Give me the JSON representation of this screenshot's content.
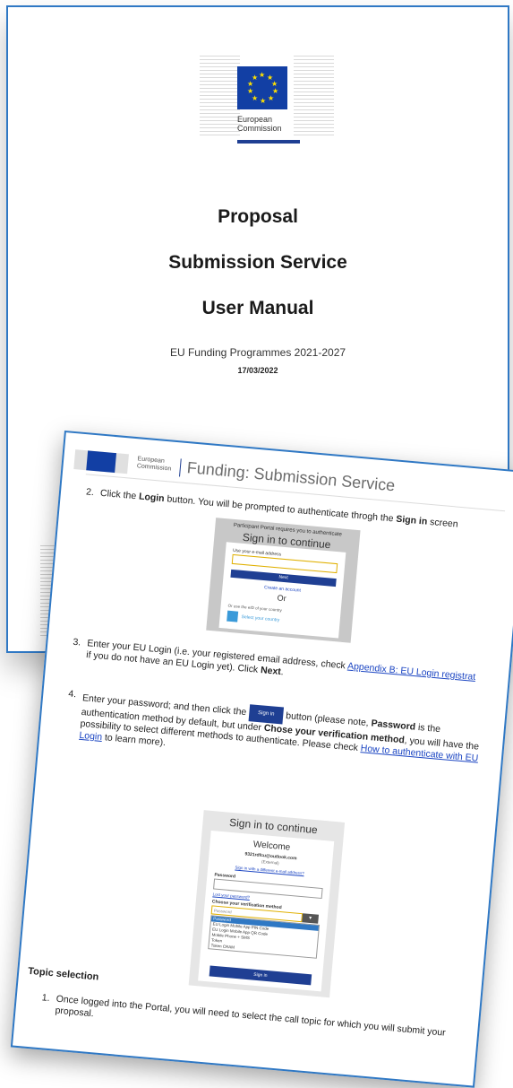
{
  "cover": {
    "org_line1": "European",
    "org_line2": "Commission",
    "title1": "Proposal",
    "title2": "Submission Service",
    "title3": "User Manual",
    "programmes": "EU Funding Programmes 2021-2027",
    "date": "17/03/2022"
  },
  "page": {
    "header": {
      "org_line1": "European",
      "org_line2": "Commission",
      "service": "Funding: Submission Service"
    },
    "step2": {
      "num": "2.",
      "pre": "Click the ",
      "bold1": "Login",
      "mid": " button. You will be prompted to authenticate throgh the ",
      "bold2": "Sign in",
      "post": " screen"
    },
    "signin1": {
      "caption": "Participant Portal requires you to authenticate",
      "heading": "Sign in to continue",
      "email_label": "Use your e-mail address",
      "next": "Next",
      "create": "Create an account",
      "or": "Or",
      "other": "Or use the eID of your country",
      "eid": "Select your country"
    },
    "step3": {
      "num": "3.",
      "pre": "Enter your EU Login (i.e. your registered email address, check ",
      "link": "Appendix B: EU Login registrat",
      "line2": "if you do not have an EU Login yet). Click ",
      "bold": "Next",
      "end": "."
    },
    "step4": {
      "num": "4.",
      "l1a": "Enter your password; and then click the ",
      "btn": "Sign in",
      "l1b": " button (please note, ",
      "l1bold": "Password",
      "l1c": " is the",
      "l2a": "authentication method by default, but under ",
      "l2bold": "Chose your verification method",
      "l2b": ", you will have the",
      "l3a": "possibility to select different methods to authenticate. Please check ",
      "l3link": "How to authenticate with EU",
      "l4link": "Login",
      "l4b": " to learn more)."
    },
    "signin2": {
      "heading": "Sign in to continue",
      "welcome": "Welcome",
      "email": "9321rdfcu@outlook.com",
      "external": "(External)",
      "different": "Sign in with a different e-mail address?",
      "password_label": "Password",
      "lost": "Lost your password?",
      "choose": "Choose your verification method",
      "selected": "Password",
      "options": [
        "Password",
        "EU Login Mobile App PIN Code",
        "EU Login Mobile App QR Code",
        "Mobile Phone + SMS",
        "Token",
        "Token CRAM"
      ],
      "signin": "Sign in"
    },
    "topic_heading": "Topic selection",
    "topic1": {
      "num": "1.",
      "text": "Once logged into the Portal, you will need to select the call topic for which you will submit your",
      "line2": "proposal."
    }
  }
}
